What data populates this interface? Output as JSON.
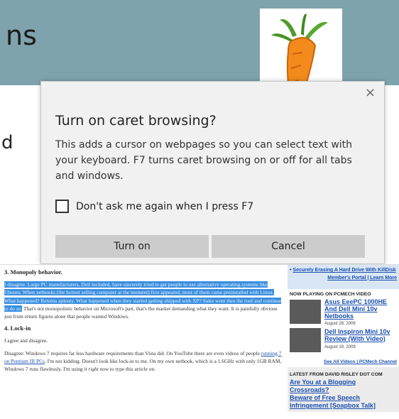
{
  "slide": {
    "title_fragment": "ns",
    "side_letter": "d",
    "header_color": "#7fa3ad"
  },
  "dialog": {
    "close_icon": "×",
    "title": "Turn on caret browsing?",
    "body": "This adds a cursor on webpages so you can select text with your keyboard. F7 turns caret browsing on or off for all tabs and windows.",
    "checkbox_label": "Don't ask me again when I press F7",
    "checkbox_checked": false,
    "primary_button": "Turn on",
    "secondary_button": "Cancel"
  },
  "article": {
    "heading1": "3. Monopoly behavior.",
    "highlighted_pre": "I disagree. Large PC manufacturers, Dell included, have sincerely ",
    "highlighted_em": "tried",
    "highlighted_post": " to get people to use alternative operating systems like Ubuntu. When netbooks (the hottest selling computer at the moment) first appeared, most of them came preinstalled with Linux. What happened? Returns aplenty. What happened when they started getting shipped with XP? Sales went thru the roof and continue to do so.",
    "para1_rest": "That's not monopolistic behavior on Microsoft's part, that's the market demanding what they want. It is painfully obvious just from return figures alone that people wanted Windows.",
    "heading2": "4. Lock-in",
    "para2": "I agree and disagree.",
    "para3_pre": "Disagree: Windows 7 requires far less hardware requirements than Vista did. On YouTube there are even videos of people ",
    "para3_link": "running 7 on Pentium III PCs",
    "para3_mid": ". I'm not kidding. Doesn't look like lock-in to me. On my own netbook, which is a 1.6GHz with only 1GB RAM, Windows 7 runs flawlessly. I'm using it ",
    "para3_em": "right now",
    "para3_end": " to type this article on."
  },
  "sidebar": {
    "top_link": "Securely Erasing A Hard Drive With KillDisk",
    "top_right": "Member's Portal | Learn More",
    "now_playing": "NOW PLAYING ON PCMECH VIDEO",
    "videos": [
      {
        "title": "Asus EeePC 1000HE And Dell Mini 10v Netbooks",
        "date": "August 28, 2009"
      },
      {
        "title": "Dell Inspiron Mini 10v Review (With Video)",
        "date": "August 19, 2009"
      }
    ],
    "see_all": "See All Videos | PCMech Channel",
    "latest_label": "LATEST FROM DAVID RISLEY DOT COM",
    "latest_links": [
      "Are You at a Blogging Crossroads?",
      "Beware of Free Speech Infringement [Soapbox Talk]"
    ]
  }
}
